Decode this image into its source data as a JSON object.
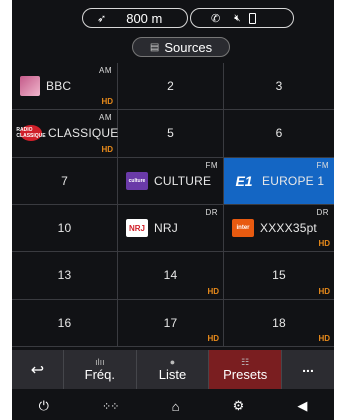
{
  "status": {
    "nav_icon": "navigation-arrow-icon",
    "distance": "800 m",
    "phone_icons": [
      "phone-icon",
      "mute-icon",
      "phone-battery-icon"
    ]
  },
  "sources": {
    "icon": "sources-icon",
    "label": "Sources"
  },
  "presets": [
    {
      "label": "BBC",
      "band": "AM",
      "hd": "HD",
      "logo": "BBC",
      "selected": false
    },
    {
      "label": "2",
      "band": "",
      "hd": "",
      "logo": "",
      "selected": false
    },
    {
      "label": "3",
      "band": "",
      "hd": "",
      "logo": "",
      "selected": false
    },
    {
      "label": "CLASSIQUE",
      "band": "AM",
      "hd": "HD",
      "logo": "RADIO CLASSIQUE",
      "selected": false
    },
    {
      "label": "5",
      "band": "",
      "hd": "",
      "logo": "",
      "selected": false
    },
    {
      "label": "6",
      "band": "",
      "hd": "",
      "logo": "",
      "selected": false
    },
    {
      "label": "7",
      "band": "",
      "hd": "",
      "logo": "",
      "selected": false
    },
    {
      "label": "CULTURE",
      "band": "FM",
      "hd": "",
      "logo": "culture",
      "selected": false
    },
    {
      "label": "EUROPE 1",
      "band": "FM",
      "hd": "",
      "logo": "E1",
      "selected": true
    },
    {
      "label": "10",
      "band": "",
      "hd": "",
      "logo": "",
      "selected": false
    },
    {
      "label": "NRJ",
      "band": "DR",
      "hd": "",
      "logo": "NRJ",
      "selected": false
    },
    {
      "label": "XXXX35pt",
      "band": "DR",
      "hd": "HD",
      "logo": "inter",
      "selected": false
    },
    {
      "label": "13",
      "band": "",
      "hd": "",
      "logo": "",
      "selected": false
    },
    {
      "label": "14",
      "band": "",
      "hd": "HD",
      "logo": "",
      "selected": false
    },
    {
      "label": "15",
      "band": "",
      "hd": "HD",
      "logo": "",
      "selected": false
    },
    {
      "label": "16",
      "band": "",
      "hd": "",
      "logo": "",
      "selected": false
    },
    {
      "label": "17",
      "band": "",
      "hd": "HD",
      "logo": "",
      "selected": false
    },
    {
      "label": "18",
      "band": "",
      "hd": "HD",
      "logo": "",
      "selected": false
    }
  ],
  "actions": {
    "back_icon": "back-icon",
    "freq": {
      "icon": "frequency-icon",
      "label": "Fréq."
    },
    "list": {
      "icon": "list-icon",
      "label": "Liste"
    },
    "presets": {
      "icon": "presets-icon",
      "label": "Presets"
    },
    "more_label": "..."
  },
  "system_bar": [
    "power-icon",
    "apps-grid-icon",
    "home-icon",
    "settings-car-icon",
    "volume-icon"
  ],
  "colors": {
    "selected": "#1466c4",
    "active_tab": "#7a1e20",
    "hd_badge": "#e88a1a",
    "background": "#111215"
  }
}
